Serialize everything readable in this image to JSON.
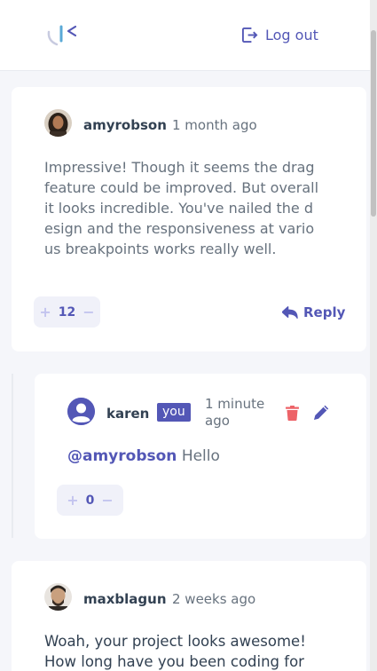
{
  "header": {
    "logout_label": "Log out",
    "colors": {
      "brand": "#5357b6",
      "accent_light": "#c3c4ef",
      "danger": "#ed6368"
    }
  },
  "comments": [
    {
      "username": "amyrobson",
      "time": "1 month ago",
      "text": "Impressive! Though it seems the drag feature could be improved. But overall it looks incredible. You've nailed the design and the responsiveness at various breakpoints works really well.",
      "score": "12",
      "reply_label": "Reply"
    },
    {
      "username": "karen",
      "you_label": "you",
      "time": "1 minute ago",
      "mention": "@amyrobson",
      "text": "Hello",
      "score": "0"
    },
    {
      "username": "maxblagun",
      "time": "2 weeks ago",
      "text": "Woah, your project looks awesome! How long have you been coding for"
    }
  ]
}
